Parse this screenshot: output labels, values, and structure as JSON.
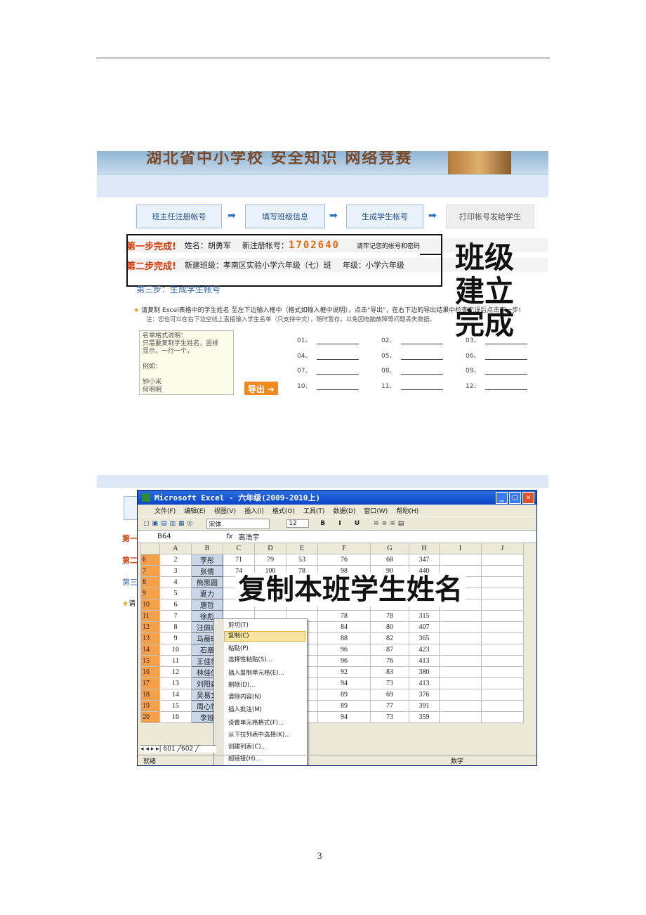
{
  "page_number": "3",
  "shot1": {
    "banner_text": "湖北省中小学校 安全知识 网络竞赛",
    "steps": [
      "班主任注册帐号",
      "填写班级信息",
      "生成学生帐号",
      "打印帐号发给学生"
    ],
    "step_arrow": "➡",
    "step1_done": "第一步完成!",
    "name_label": "姓名：胡勇军",
    "acct_label": "新注册帐号：",
    "acct_value": "1702640",
    "acct_note": "请牢记您的帐号和密码",
    "step2_done": "第二步完成!",
    "class_label": "新建班级：孝南区实验小学六年级（七）班",
    "grade_label": "年级：小学六年级",
    "step3_title": "第三步：生成学生帐号",
    "instruction": "请复制 Excel表格中的学生姓名 至左下边输入框中（格式如输入框中说明），点击\"导出\"，在右下边的导出结果中检查无误后点击下一步!",
    "note": "注：您也可以在右下边空线上直接输入学生名单（只支持中文），随时暂存，以免因电脑故障等问题丢失数据。",
    "textarea_lines": [
      "名单格式说明：",
      "只需要复制学生姓名，竖排",
      "显示，一行一个，",
      "",
      "例如：",
      "",
      "钟小米",
      "何明明"
    ],
    "export_button": "导出 ➜",
    "slots": [
      "01、",
      "02、",
      "03、",
      "04、",
      "05、",
      "06、",
      "07、",
      "08、",
      "09、",
      "10、",
      "11、",
      "12、"
    ],
    "overlay_lines": [
      "班级",
      "建立",
      "完成"
    ]
  },
  "shot2": {
    "title": "Microsoft Excel - 六年级(2009-2010上)",
    "menu": [
      "文件(F)",
      "编辑(E)",
      "视图(V)",
      "插入(I)",
      "格式(O)",
      "工具(T)",
      "数据(D)",
      "窗口(W)",
      "帮助(H)"
    ],
    "font_name": "宋体",
    "font_size": "12",
    "cell_ref": "B64",
    "formula_value": "高浩宇",
    "columns": [
      "A",
      "B",
      "C",
      "D",
      "E",
      "F",
      "G",
      "H",
      "I",
      "J"
    ],
    "rows": [
      [
        "6",
        "2",
        "李彤",
        "71",
        "79",
        "53",
        "76",
        "68",
        "347"
      ],
      [
        "7",
        "3",
        "张倩",
        "74",
        "100",
        "78",
        "98",
        "90",
        "440"
      ],
      [
        "8",
        "4",
        "熊思圆",
        "7",
        "",
        "",
        "",
        "",
        ""
      ],
      [
        "9",
        "5",
        "夏力",
        "7",
        "",
        "",
        "",
        "",
        ""
      ],
      [
        "10",
        "6",
        "唐哲",
        "75",
        "82",
        "86",
        "94",
        "68",
        "405"
      ],
      [
        "11",
        "7",
        "徐彪",
        "",
        "",
        "",
        "78",
        "78",
        "315"
      ],
      [
        "12",
        "8",
        "汪佩琪",
        "",
        "",
        "",
        "84",
        "80",
        "407"
      ],
      [
        "13",
        "9",
        "马晨瑞",
        "",
        "",
        "",
        "88",
        "82",
        "365"
      ],
      [
        "14",
        "10",
        "石章",
        "",
        "",
        "",
        "96",
        "87",
        "423"
      ],
      [
        "15",
        "11",
        "王佳怡",
        "",
        "",
        "",
        "96",
        "76",
        "413"
      ],
      [
        "16",
        "12",
        "林佳仪",
        "",
        "",
        "",
        "92",
        "83",
        "380"
      ],
      [
        "17",
        "13",
        "刘阳森",
        "",
        "",
        "",
        "94",
        "73",
        "413"
      ],
      [
        "18",
        "14",
        "吴易文",
        "",
        "",
        "",
        "89",
        "69",
        "376"
      ],
      [
        "19",
        "15",
        "周心怡",
        "",
        "",
        "",
        "89",
        "77",
        "391"
      ],
      [
        "20",
        "16",
        "李娅",
        "",
        "",
        "",
        "94",
        "73",
        "359"
      ]
    ],
    "context_menu": [
      "剪切(T)",
      "复制(C)",
      "粘贴(P)",
      "选择性粘贴(S)...",
      "插入复制单元格(E)...",
      "删除(D)...",
      "清除内容(N)",
      "插入批注(M)",
      "设置单元格格式(F)...",
      "从下拉列表中选择(K)...",
      "创建列表(C)...",
      "超链接(H)..."
    ],
    "sheet_tabs": "601 ╱602 ╱",
    "status_ready": "就绪",
    "status_num": "数字",
    "overlay": "复制本班学生姓名",
    "side_labels": [
      "第一",
      "第二",
      "第三",
      "请"
    ]
  }
}
